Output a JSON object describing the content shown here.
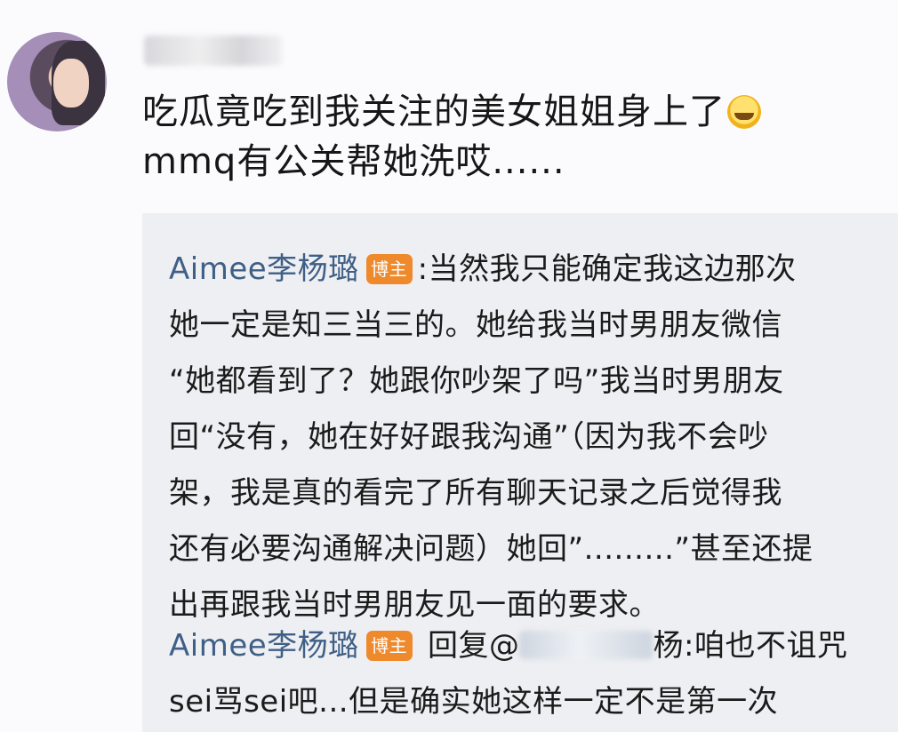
{
  "post": {
    "main_text_line1": "吃瓜竟吃到我关注的美女姐姐身上了",
    "emoji": "laughing-crying-emoji",
    "main_text_line2": "mmq有公关帮她洗哎......"
  },
  "comments": [
    {
      "author": "Aimee李杨璐",
      "badge": "博主",
      "sep": ":",
      "lines": [
        "当然我只能确定我这边那次",
        "她一定是知三当三的。她给我当时男朋友微信",
        "“她都看到了？她跟你吵架了吗”我当时男朋友",
        "回“没有，她在好好跟我沟通”（因为我不会吵",
        "架，我是真的看完了所有聊天记录之后觉得我",
        "还有必要沟通解决问题）她回”.........”甚至还提",
        "出再跟我当时男朋友见一面的要求。"
      ]
    },
    {
      "author": "Aimee李杨璐",
      "badge": "博主",
      "reply_prefix": "回复@",
      "reply_suffix": "杨:",
      "first_text": "咱也不诅咒",
      "lines": [
        "sei骂sei吧...但是确实她这样一定不是第一次"
      ]
    }
  ]
}
